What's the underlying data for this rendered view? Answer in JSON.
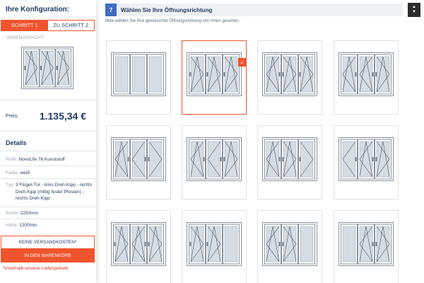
{
  "sidebar": {
    "title": "Ihre Konfiguration:",
    "steps": [
      "SCHRITT 1",
      "ZU SCHRITT 2"
    ],
    "innen_label": "INNENANSICHT:",
    "price_label": "Preis:",
    "price_value": "1.135,34 €",
    "details_title": "Details",
    "profil_key": "Profil:",
    "profil_value": "NovoLife 76 Kunststoff",
    "farbe_key": "Farbe:",
    "farbe_value": "weiß",
    "typ_key": "Typ:",
    "typ_value": "3 Flügel-Tür - links Dreh-Kipp - rechts Dreh-Kipp (mittig fester Pfosten) - rechts Dreh-Kipp",
    "breite_key": "Breite:",
    "breite_value": "2250mm",
    "hoehe_key": "Höhe:",
    "hoehe_value": "1200mm",
    "versand_label": "KEINE VERSANDKOSTEN*",
    "cart_label": "IN DEN WARENKORB",
    "footnote": "*innerhalb unserer Liefergebiete"
  },
  "main": {
    "step_number": "7",
    "title": "Wählen Sie Ihre Öffnungsrichtung",
    "subtitle": "Bitte wählen Sie Ihre gewünschte Öffnungsrichtung von innen gesehen."
  },
  "colors": {
    "accent": "#f0542d",
    "step_blue": "#3f6cc0",
    "text": "#1f3a5f"
  },
  "options": [
    {
      "sashes": [
        "fixed",
        "fixed",
        "fixed"
      ]
    },
    {
      "sashes": [
        "tilt-right",
        "tilt-right",
        "tilt-right"
      ],
      "selected": true
    },
    {
      "sashes": [
        "tilt-left",
        "tilt-right",
        "tilt-right"
      ]
    },
    {
      "sashes": [
        "tilt-left",
        "tilt-left",
        "tilt-right"
      ]
    },
    {
      "sashes": [
        "tilt-left",
        "turn-left",
        "turn-right"
      ]
    },
    {
      "sashes": [
        "tilt-left",
        "turn-left",
        "tilt-right"
      ]
    },
    {
      "sashes": [
        "tilt-left",
        "tilt-right",
        "turn-right"
      ]
    },
    {
      "sashes": [
        "turn-left",
        "tilt-left",
        "tilt-right"
      ]
    },
    {
      "sashes": [
        "tilt-right",
        "tilt-left",
        "tilt-right"
      ]
    },
    {
      "sashes": [
        "tilt-right",
        "tilt-right",
        "fixed"
      ]
    },
    {
      "sashes": [
        "tilt-left",
        "tilt-right",
        "fixed"
      ]
    },
    {
      "sashes": [
        "fixed",
        "tilt-left",
        "tilt-right"
      ]
    }
  ]
}
